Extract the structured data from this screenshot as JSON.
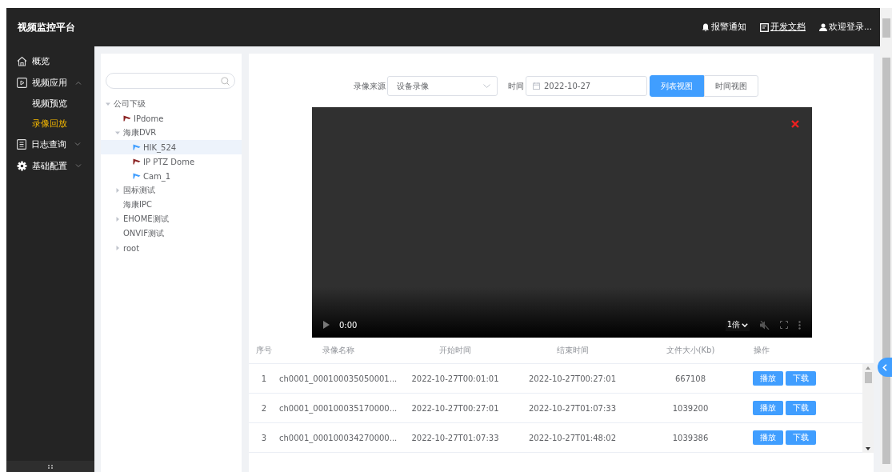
{
  "app_title": "视频监控平台",
  "header_links": [
    {
      "kind": "bell",
      "label": "报警通知",
      "underlined": false
    },
    {
      "kind": "doc",
      "label": "开发文档",
      "underlined": true
    },
    {
      "kind": "user",
      "label": "欢迎登录..."
    }
  ],
  "sidebar": [
    {
      "kind": "home",
      "label": "概览"
    },
    {
      "kind": "play",
      "label": "视频应用",
      "expanded": true,
      "children": [
        {
          "label": "视频预览",
          "selected": false
        },
        {
          "label": "录像回放",
          "selected": true
        }
      ]
    },
    {
      "kind": "log",
      "label": "日志查询",
      "expanded": false
    },
    {
      "kind": "gear",
      "label": "基础配置",
      "expanded": false
    }
  ],
  "tree": [
    {
      "label": "公司下级",
      "expanded": true,
      "selected": false,
      "children": [
        {
          "label": "IPdome",
          "kind": "camera",
          "color": "#8b2323",
          "selected": false
        },
        {
          "label": "海康DVR",
          "expanded": true,
          "selected": false,
          "children": [
            {
              "label": "HIK_524",
              "kind": "camera",
              "color": "#409eff",
              "selected": true
            },
            {
              "label": "IP PTZ Dome",
              "kind": "camera",
              "color": "#8b2323",
              "selected": false
            },
            {
              "label": "Cam_1",
              "kind": "camera",
              "color": "#409eff",
              "selected": false
            }
          ]
        },
        {
          "label": "国标测试",
          "expanded": false,
          "selected": false
        },
        {
          "label": "海康IPC",
          "selected": false
        },
        {
          "label": "EHOME测试",
          "expanded": false,
          "selected": false
        },
        {
          "label": "ONVIF测试",
          "selected": false
        },
        {
          "label": "root",
          "expanded": false,
          "selected": false
        }
      ]
    }
  ],
  "filter": {
    "source_label": "录像来源",
    "source_value": "设备录像",
    "time_label": "时间",
    "date_value": "2022-10-27",
    "views": [
      {
        "label": "列表视图",
        "selected": true
      },
      {
        "label": "时间视图",
        "selected": false
      }
    ]
  },
  "player": {
    "time": "0:00",
    "speed": "1倍",
    "muted": true
  },
  "table": {
    "columns": [
      "序号",
      "录像名称",
      "开始时间",
      "结束时间",
      "文件大小(Kb)",
      "操作"
    ],
    "rows": [
      {
        "cells": [
          "1",
          "ch0001_000100035050001...",
          "2022-10-27T00:01:01",
          "2022-10-27T00:27:01",
          "667108"
        ],
        "actions": [
          "播放",
          "下载"
        ]
      },
      {
        "cells": [
          "2",
          "ch0001_000100035170000...",
          "2022-10-27T00:27:01",
          "2022-10-27T01:07:33",
          "1039200"
        ],
        "actions": [
          "播放",
          "下载"
        ]
      },
      {
        "cells": [
          "3",
          "ch0001_000100034270000...",
          "2022-10-27T01:07:33",
          "2022-10-27T01:48:02",
          "1039386"
        ],
        "actions": [
          "播放",
          "下载"
        ]
      }
    ]
  }
}
